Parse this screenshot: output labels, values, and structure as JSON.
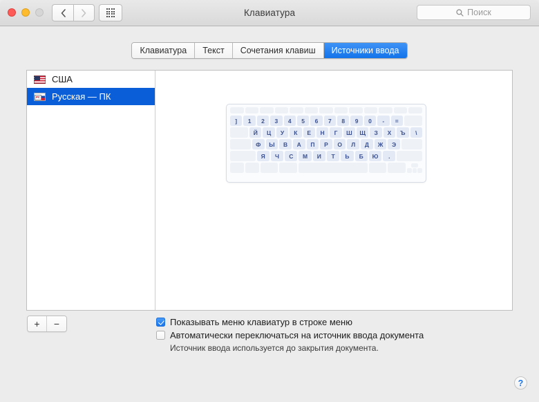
{
  "window": {
    "title": "Клавиатура",
    "traffic_lights": [
      "close-button",
      "minimize-button",
      "zoom-button"
    ],
    "nav": {
      "back": "‹",
      "forward": "›"
    },
    "grid_button": "show-all-preferences"
  },
  "search": {
    "placeholder": "Поиск",
    "value": "",
    "icon": "search-icon"
  },
  "tabs": [
    {
      "label": "Клавиатура",
      "active": false
    },
    {
      "label": "Текст",
      "active": false
    },
    {
      "label": "Сочетания клавиш",
      "active": false
    },
    {
      "label": "Источники ввода",
      "active": true
    }
  ],
  "input_sources": [
    {
      "label": "США",
      "flag": "us-flag-icon",
      "badge": "",
      "selected": false
    },
    {
      "label": "Русская — ПК",
      "flag": "ru-flag-icon",
      "badge": "РС",
      "selected": true
    }
  ],
  "list_buttons": {
    "add": "+",
    "remove": "−"
  },
  "keyboard_preview": {
    "rows": [
      {
        "name": "function-row",
        "keys": [
          "",
          "",
          "",
          "",
          "",
          "",
          "",
          "",
          "",
          "",
          "",
          "",
          ""
        ]
      },
      {
        "name": "number-row",
        "keys": [
          "]",
          "1",
          "2",
          "3",
          "4",
          "5",
          "6",
          "7",
          "8",
          "9",
          "0",
          "-",
          "=",
          ""
        ]
      },
      {
        "name": "top-letter-row",
        "keys": [
          "",
          "Й",
          "Ц",
          "У",
          "К",
          "Е",
          "Н",
          "Г",
          "Ш",
          "Щ",
          "З",
          "Х",
          "Ъ",
          "\\"
        ]
      },
      {
        "name": "home-row",
        "keys": [
          "",
          "Ф",
          "Ы",
          "В",
          "А",
          "П",
          "Р",
          "О",
          "Л",
          "Д",
          "Ж",
          "Э",
          ""
        ]
      },
      {
        "name": "bottom-letter-row",
        "keys": [
          "",
          "Я",
          "Ч",
          "С",
          "М",
          "И",
          "Т",
          "Ь",
          "Б",
          "Ю",
          ".",
          ""
        ]
      },
      {
        "name": "modifier-row",
        "keys": [
          "",
          "",
          "",
          "",
          "",
          "",
          "",
          ""
        ]
      }
    ]
  },
  "options": [
    {
      "label": "Показывать меню клавиатур в строке меню",
      "checked": true,
      "note": ""
    },
    {
      "label": "Автоматически переключаться на источник ввода документа",
      "checked": false,
      "note": "Источник ввода используется до закрытия документа."
    }
  ],
  "help": {
    "label": "?"
  },
  "colors": {
    "accent_blue": "#0a5ed7",
    "tab_blue": "#1273ea",
    "key_text": "#3c5190",
    "window_bg": "#ececec"
  }
}
